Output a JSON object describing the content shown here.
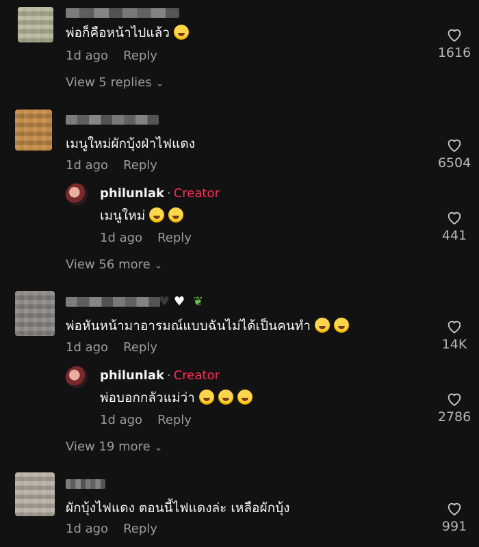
{
  "comments": [
    {
      "text": "พ่อก็คือหน้าไปแล้ว",
      "emoji_count": 1,
      "time": "1d ago",
      "reply_label": "Reply",
      "likes": "1616",
      "view_replies": "View 5 replies"
    },
    {
      "text": "เมนูใหม่ผักบุ้งฝ่าไฟแดง",
      "time": "1d ago",
      "reply_label": "Reply",
      "likes": "6504",
      "creator_reply": {
        "username": "philunlak",
        "separator": "·",
        "tag": "Creator",
        "text": "เมนูใหม่",
        "emoji_count": 2,
        "time": "1d ago",
        "reply_label": "Reply",
        "likes": "441"
      },
      "view_more": "View 56 more"
    },
    {
      "text": "พ่อหันหน้ามาอารมณ์แบบฉันไม่ได้เป็นคนทำ",
      "emoji_count": 2,
      "time": "1d ago",
      "reply_label": "Reply",
      "likes": "14K",
      "creator_reply": {
        "username": "philunlak",
        "separator": "·",
        "tag": "Creator",
        "text": "พ่อบอกกลัวแม่ว่า",
        "emoji_count": 3,
        "time": "1d ago",
        "reply_label": "Reply",
        "likes": "2786"
      },
      "view_more": "View 19 more"
    },
    {
      "text": "ผักบุ้งไฟแดง ตอนนี้ไฟแดงล่ะ เหลือผักบุ้ง",
      "time": "1d ago",
      "reply_label": "Reply",
      "likes": "991"
    }
  ],
  "icons": {
    "like": "heart-outline-icon",
    "expand": "chevron-down-icon"
  },
  "colors": {
    "background": "#121212",
    "creator_tag": "#fe2c55",
    "secondary_text": "#9c9c9c"
  }
}
